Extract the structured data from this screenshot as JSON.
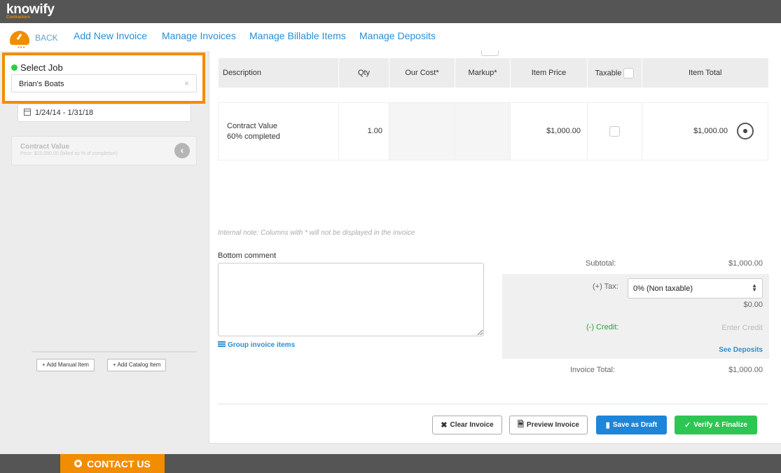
{
  "app": {
    "logo": "knowify",
    "logo_sub": "Contractors"
  },
  "nav": {
    "back_label": "BACK",
    "links": [
      "Add New Invoice",
      "Manage Invoices",
      "Manage Billable Items",
      "Manage Deposits"
    ]
  },
  "sidebar": {
    "select_job_label": "Select Job",
    "selected_job": "Brian's Boats",
    "clear_glyph": "×",
    "date_range": "1/24/14 - 1/31/18",
    "contract_card": {
      "title": "Contract Value",
      "subtitle": "Price: $10,000.00 (billed as % of completion)",
      "arrow": "‹"
    },
    "add_manual": "+ Add Manual Item",
    "add_catalog": "+ Add Catalog Item"
  },
  "table": {
    "headers": [
      "Description",
      "Qty",
      "Our Cost*",
      "Markup*",
      "Item Price",
      "Taxable",
      "Item Total"
    ],
    "row": {
      "description": "Contract Value",
      "description_sub": "60% completed",
      "qty": "1.00",
      "our_cost": "",
      "markup": "",
      "item_price": "$1,000.00",
      "taxable": false,
      "item_total": "$1,000.00"
    }
  },
  "internal_note": "Internal note: Columns with * will not be displayed in the invoice",
  "bottom_comment": {
    "label": "Bottom comment",
    "value": ""
  },
  "group_items_label": "Group invoice items",
  "totals": {
    "subtotal_label": "Subtotal:",
    "subtotal": "$1,000.00",
    "tax_label": "(+) Tax:",
    "tax_option": "0% (Non taxable)",
    "tax_amount": "$0.00",
    "credit_label": "(-) Credit:",
    "credit_placeholder": "Enter Credit",
    "see_deposits": "See Deposits",
    "invoice_total_label": "Invoice Total:",
    "invoice_total": "$1,000.00"
  },
  "actions": {
    "clear": "Clear Invoice",
    "preview": "Preview Invoice",
    "draft": "Save as Draft",
    "finalize": "Verify & Finalize"
  },
  "footer": {
    "contact": "CONTACT US"
  },
  "colors": {
    "accent_orange": "#f28c00",
    "link_blue": "#2a8fd4",
    "save_blue": "#1e85d8",
    "finalize_green": "#2dc653",
    "credit_green": "#2e9e3e"
  }
}
